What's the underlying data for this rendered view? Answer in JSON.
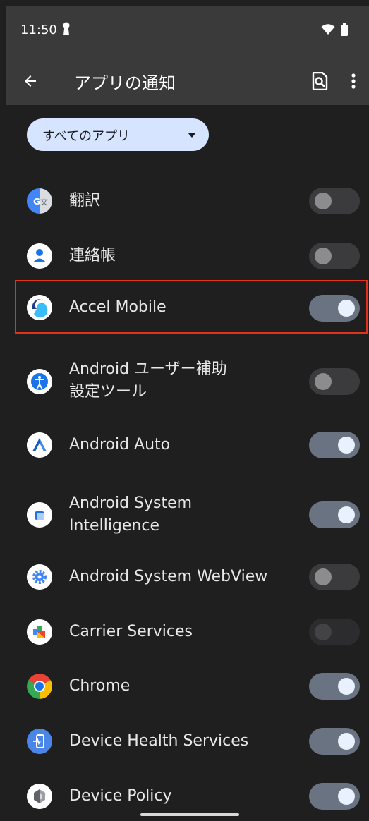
{
  "status_bar": {
    "time": "11:50"
  },
  "app_bar": {
    "title": "アプリの通知"
  },
  "filter": {
    "selected": "すべてのアプリ"
  },
  "apps": [
    {
      "name": "翻訳",
      "toggle": "off",
      "icon": "translate-icon"
    },
    {
      "name": "連絡帳",
      "toggle": "off",
      "icon": "contacts-icon"
    },
    {
      "name": "Accel Mobile",
      "toggle": "on",
      "icon": "accel-mobile-icon",
      "highlighted": true
    },
    {
      "name": "Android ユーザー補助\n設定ツール",
      "toggle": "off",
      "icon": "accessibility-icon"
    },
    {
      "name": "Android Auto",
      "toggle": "on",
      "icon": "android-auto-icon"
    },
    {
      "name": "Android System\nIntelligence",
      "toggle": "on",
      "icon": "system-intelligence-icon"
    },
    {
      "name": "Android System WebView",
      "toggle": "off",
      "icon": "webview-gear-icon"
    },
    {
      "name": "Carrier Services",
      "toggle": "disabled",
      "icon": "carrier-services-icon"
    },
    {
      "name": "Chrome",
      "toggle": "on",
      "icon": "chrome-icon"
    },
    {
      "name": "Device Health Services",
      "toggle": "on",
      "icon": "device-health-icon"
    },
    {
      "name": "Device Policy",
      "toggle": "on",
      "icon": "device-policy-icon"
    }
  ],
  "colors": {
    "highlight_border": "#e1321b",
    "filter_chip": "#d6e4ff",
    "toggle_on_track": "#6a7381",
    "toggle_off_track": "#3b3b3d"
  }
}
